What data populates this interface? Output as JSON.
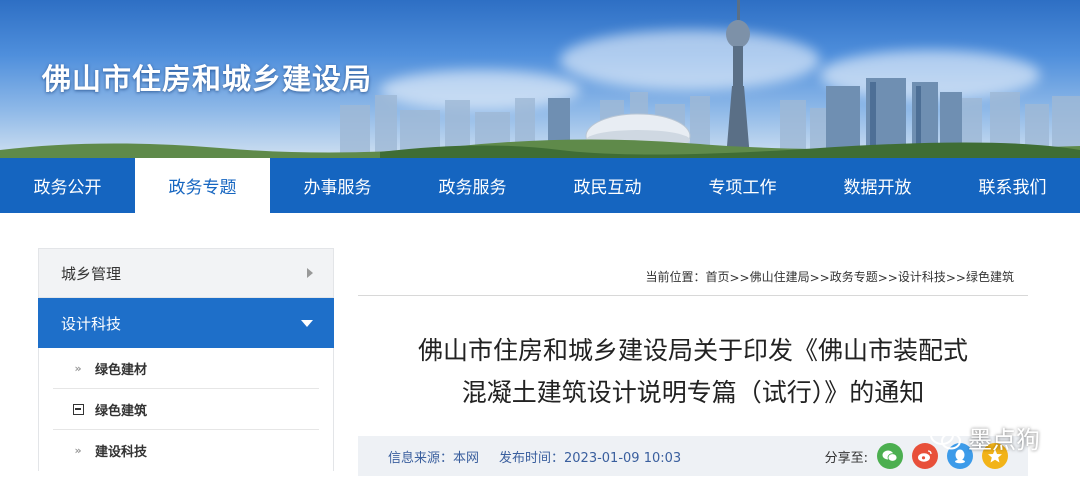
{
  "site": {
    "title": "佛山市住房和城乡建设局"
  },
  "nav": {
    "items": [
      {
        "label": "政务公开"
      },
      {
        "label": "政务专题"
      },
      {
        "label": "办事服务"
      },
      {
        "label": "政务服务"
      },
      {
        "label": "政民互动"
      },
      {
        "label": "专项工作"
      },
      {
        "label": "数据开放"
      },
      {
        "label": "联系我们"
      }
    ],
    "active_index": 1
  },
  "sidebar": {
    "section1": {
      "label": "城乡管理"
    },
    "section2": {
      "label": "设计科技"
    },
    "items": [
      {
        "label": "绿色建材",
        "icon": "double-chevron-icon"
      },
      {
        "label": "绿色建筑",
        "icon": "minus-box-icon"
      },
      {
        "label": "建设科技",
        "icon": "double-chevron-icon"
      }
    ]
  },
  "breadcrumb": {
    "prefix": "当前位置：",
    "items": [
      "首页",
      "佛山住建局",
      "政务专题",
      "设计科技",
      "绿色建筑"
    ],
    "separator": ">>"
  },
  "article": {
    "title_line1": "佛山市住房和城乡建设局关于印发《佛山市装配式",
    "title_line2": "混凝土建筑设计说明专篇（试行）》的通知",
    "source": "信息来源：本网",
    "publish_time": "发布时间：2023-01-09 10:03",
    "share_label": "分享至:"
  },
  "share_buttons": [
    {
      "name": "wechat",
      "color": "#4caf50"
    },
    {
      "name": "weibo",
      "color": "#e8503a"
    },
    {
      "name": "qq",
      "color": "#3d9be9"
    },
    {
      "name": "qzone",
      "color": "#f2b318"
    }
  ],
  "watermark": {
    "text": "墨点狗"
  }
}
